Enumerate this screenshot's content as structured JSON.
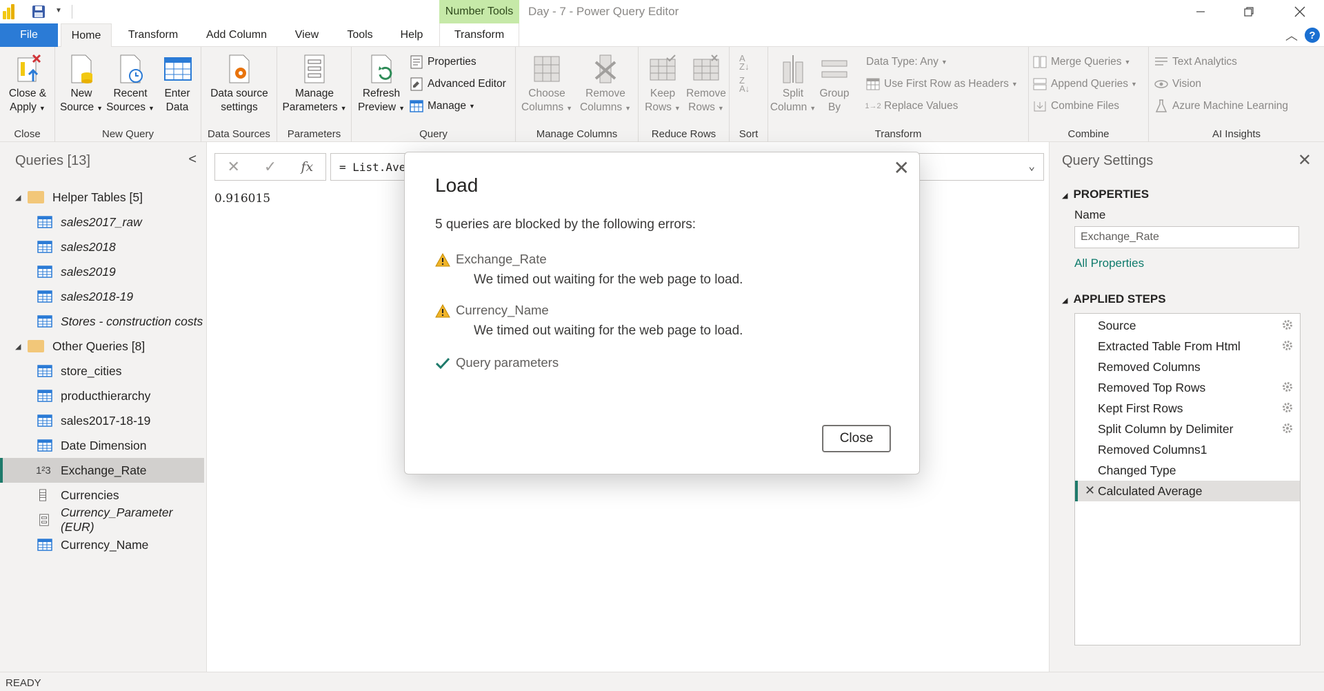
{
  "window": {
    "context_tab_header": "Number Tools",
    "title": "Day - 7 - Power Query Editor"
  },
  "tabs": [
    {
      "label": "File"
    },
    {
      "label": "Home"
    },
    {
      "label": "Transform"
    },
    {
      "label": "Add Column"
    },
    {
      "label": "View"
    },
    {
      "label": "Tools"
    },
    {
      "label": "Help"
    },
    {
      "label": "Transform"
    }
  ],
  "ribbon": {
    "close": {
      "btn1": "Close &",
      "btn2": "Apply",
      "label": "Close"
    },
    "new_query": {
      "new_source_1": "New",
      "new_source_2": "Source",
      "recent_1": "Recent",
      "recent_2": "Sources",
      "enter_1": "Enter",
      "enter_2": "Data",
      "label": "New Query"
    },
    "data_sources": {
      "btn1": "Data source",
      "btn2": "settings",
      "label": "Data Sources"
    },
    "parameters": {
      "btn1": "Manage",
      "btn2": "Parameters",
      "label": "Parameters"
    },
    "query": {
      "refresh_1": "Refresh",
      "refresh_2": "Preview",
      "properties": "Properties",
      "advanced_editor": "Advanced Editor",
      "manage": "Manage",
      "label": "Query"
    },
    "manage_columns": {
      "choose_1": "Choose",
      "choose_2": "Columns",
      "remove_1": "Remove",
      "remove_2": "Columns",
      "label": "Manage Columns"
    },
    "reduce_rows": {
      "keep_1": "Keep",
      "keep_2": "Rows",
      "remove_1": "Remove",
      "remove_2": "Rows",
      "label": "Reduce Rows"
    },
    "sort": {
      "label": "Sort"
    },
    "transform": {
      "split_1": "Split",
      "split_2": "Column",
      "group_1": "Group",
      "group_2": "By",
      "data_type": "Data Type: Any",
      "first_row": "Use First Row as Headers",
      "replace": "Replace Values",
      "label": "Transform"
    },
    "combine": {
      "merge": "Merge Queries",
      "append": "Append Queries",
      "combine_files": "Combine Files",
      "label": "Combine"
    },
    "ai": {
      "text": "Text Analytics",
      "vision": "Vision",
      "azure": "Azure Machine Learning",
      "label": "AI Insights"
    }
  },
  "queries": {
    "title": "Queries [13]",
    "groups": [
      {
        "name": "Helper Tables [5]",
        "items": [
          "sales2017_raw",
          "sales2018",
          "sales2019",
          "sales2018-19",
          "Stores - construction costs"
        ]
      },
      {
        "name": "Other Queries [8]",
        "items": [
          "store_cities",
          "producthierarchy",
          "sales2017-18-19",
          "Date Dimension",
          "Exchange_Rate",
          "Currencies",
          "Currency_Parameter (EUR)",
          "Currency_Name"
        ]
      }
    ],
    "exchange_rate_icon": "1²3"
  },
  "formula": {
    "fx": "fx",
    "text": "= List.Ave",
    "value": "0.916015"
  },
  "settings": {
    "title": "Query Settings",
    "properties_head": "PROPERTIES",
    "name_label": "Name",
    "name_value": "Exchange_Rate",
    "all_properties": "All Properties",
    "steps_head": "APPLIED STEPS",
    "steps": [
      "Source",
      "Extracted Table From Html",
      "Removed Columns",
      "Removed Top Rows",
      "Kept First Rows",
      "Split Column by Delimiter",
      "Removed Columns1",
      "Changed Type",
      "Calculated Average"
    ]
  },
  "status": {
    "text": "READY"
  },
  "dialog": {
    "title": "Load",
    "message": "5 queries are blocked by the following errors:",
    "errors": [
      {
        "name": "Exchange_Rate",
        "detail": "We timed out waiting for the web page to load."
      },
      {
        "name": "Currency_Name",
        "detail": "We timed out waiting for the web page to load."
      }
    ],
    "ok_item": "Query parameters",
    "close_button": "Close"
  },
  "colors": {
    "accent": "#2b7bd6",
    "selection_bar": "#1e7a6b",
    "context_tab": "#c6e9a8",
    "warning": "#f0b429",
    "check": "#1e7a6b"
  }
}
